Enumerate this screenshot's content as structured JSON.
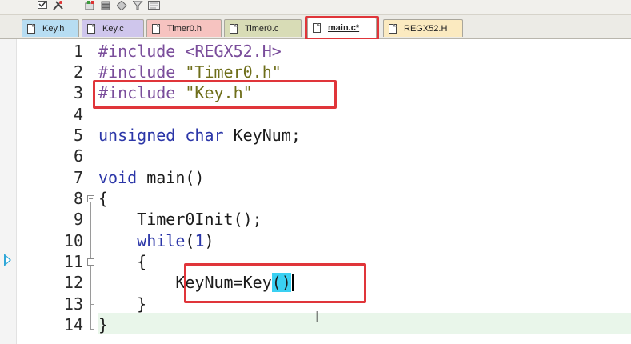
{
  "toolbar": {
    "icons": [
      "checkbox-icon",
      "tools-icon",
      "batch-build-icon",
      "stack-icon",
      "diamond-icon",
      "filter-icon",
      "debug-window-icon"
    ]
  },
  "tabs": [
    {
      "label": "Key.h",
      "color": "#b7ddf2",
      "active": false
    },
    {
      "label": "Key.c",
      "color": "#cfc6ec",
      "active": false
    },
    {
      "label": "Timer0.h",
      "color": "#f6c3c0",
      "active": false
    },
    {
      "label": "Timer0.c",
      "color": "#d8dcb6",
      "active": false
    },
    {
      "label": "main.c*",
      "color": "#ffffff",
      "active": true
    },
    {
      "label": "REGX52.H",
      "color": "#fbeac0",
      "active": false
    }
  ],
  "editor": {
    "current_line": 12,
    "breakpoint_arrow_line": 9,
    "lines": [
      {
        "n": "1",
        "text": "#include <REGX52.H>"
      },
      {
        "n": "2",
        "text": "#include \"Timer0.h\""
      },
      {
        "n": "3",
        "text": "#include \"Key.h\""
      },
      {
        "n": "4",
        "text": ""
      },
      {
        "n": "5",
        "text": "unsigned char KeyNum;"
      },
      {
        "n": "6",
        "text": ""
      },
      {
        "n": "7",
        "text": "void main()"
      },
      {
        "n": "8",
        "text": "{"
      },
      {
        "n": "9",
        "text": "    Timer0Init();"
      },
      {
        "n": "10",
        "text": "    while(1)"
      },
      {
        "n": "11",
        "text": "    {"
      },
      {
        "n": "12",
        "text": "        KeyNum=Key()"
      },
      {
        "n": "13",
        "text": "    }"
      },
      {
        "n": "14",
        "text": "}"
      }
    ]
  },
  "colors": {
    "preprocessor": "#7a4d9b",
    "string": "#6e6e1a",
    "keyword": "#2b36a8",
    "annotation": "#e0353a",
    "current_line_bg": "#e9f6ea",
    "bracket_match": "#3ad0f2"
  }
}
